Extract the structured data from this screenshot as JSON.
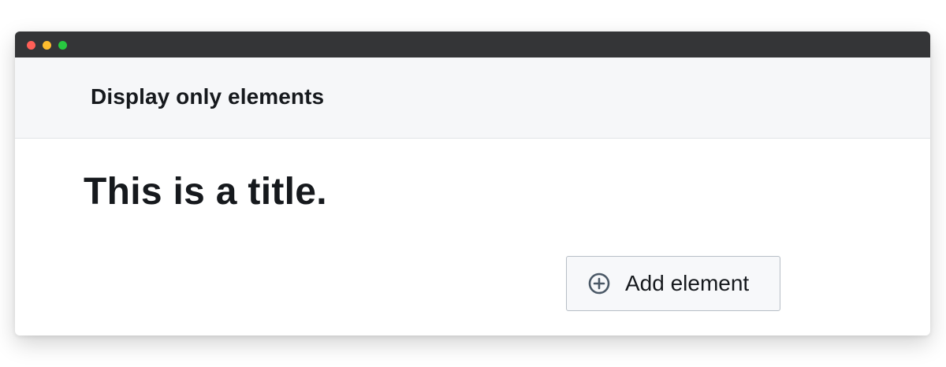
{
  "window": {
    "controls": [
      "close",
      "minimize",
      "maximize"
    ]
  },
  "header": {
    "title": "Display only elements"
  },
  "main": {
    "title": "This is a title.",
    "add_button": {
      "label": "Add element",
      "icon": "plus-circle-icon"
    }
  },
  "colors": {
    "titlebar": "#343537",
    "header_bg": "#f6f7f9",
    "text": "#16191d",
    "icon": "#4a5866"
  }
}
